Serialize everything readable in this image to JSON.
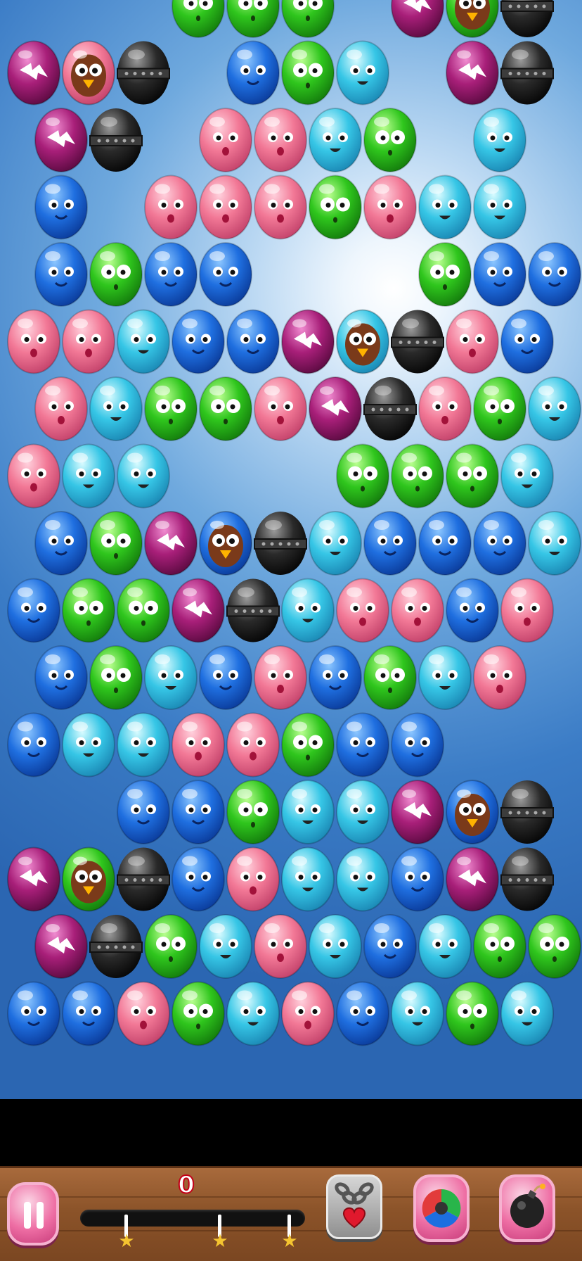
{
  "game": {
    "score": "0",
    "progress_fraction": 0.0,
    "star_thresholds": [
      0.2,
      0.62,
      0.92
    ]
  },
  "colors": {
    "blue": "#1f6fe0",
    "green": "#2fc61d",
    "pink": "#f27896",
    "cyan": "#36c6e6",
    "purple": "#a81f79",
    "black": "#2a2a2a"
  },
  "bubble_rows": [
    {
      "offset": false,
      "cells": [
        "",
        "",
        "",
        "green",
        "green",
        "green",
        "",
        "purple",
        "bird-green",
        "black"
      ]
    },
    {
      "offset": false,
      "cells": [
        "purple",
        "bird-pink",
        "black",
        "",
        "blue",
        "green",
        "cyan",
        "",
        "purple",
        "black"
      ]
    },
    {
      "offset": true,
      "cells": [
        "purple",
        "black",
        "",
        "pink",
        "pink",
        "cyan",
        "green",
        "",
        "cyan",
        ""
      ]
    },
    {
      "offset": true,
      "cells": [
        "blue",
        "",
        "pink",
        "pink",
        "pink",
        "green",
        "pink",
        "cyan",
        "cyan",
        ""
      ]
    },
    {
      "offset": true,
      "cells": [
        "blue",
        "green",
        "blue",
        "blue",
        "",
        "",
        "",
        "green",
        "blue",
        "blue"
      ]
    },
    {
      "offset": false,
      "cells": [
        "pink",
        "pink",
        "cyan",
        "blue",
        "blue",
        "purple",
        "bird-cyan",
        "black",
        "pink",
        "blue"
      ]
    },
    {
      "offset": true,
      "cells": [
        "pink",
        "cyan",
        "green",
        "green",
        "pink",
        "purple",
        "black",
        "pink",
        "green",
        "cyan"
      ]
    },
    {
      "offset": false,
      "cells": [
        "pink",
        "cyan",
        "cyan",
        "",
        "",
        "",
        "green",
        "green",
        "green",
        "cyan"
      ]
    },
    {
      "offset": true,
      "cells": [
        "blue",
        "green",
        "purple",
        "bird-blue",
        "black",
        "cyan",
        "blue",
        "blue",
        "blue",
        "cyan"
      ]
    },
    {
      "offset": false,
      "cells": [
        "blue",
        "green",
        "green",
        "purple",
        "black",
        "cyan",
        "pink",
        "pink",
        "blue",
        "pink"
      ]
    },
    {
      "offset": true,
      "cells": [
        "blue",
        "green",
        "cyan",
        "blue",
        "pink",
        "blue",
        "green",
        "cyan",
        "pink",
        ""
      ]
    },
    {
      "offset": false,
      "cells": [
        "blue",
        "cyan",
        "cyan",
        "pink",
        "pink",
        "green",
        "blue",
        "blue",
        "",
        ""
      ]
    },
    {
      "offset": false,
      "cells": [
        "",
        "",
        "blue",
        "blue",
        "green",
        "cyan",
        "cyan",
        "purple",
        "bird-blue",
        "black"
      ]
    },
    {
      "offset": false,
      "cells": [
        "purple",
        "bird-green",
        "black",
        "blue",
        "pink",
        "cyan",
        "cyan",
        "blue",
        "purple",
        "black"
      ]
    },
    {
      "offset": true,
      "cells": [
        "purple",
        "black",
        "green",
        "cyan",
        "pink",
        "cyan",
        "blue",
        "cyan",
        "green",
        "green"
      ]
    },
    {
      "offset": false,
      "cells": [
        "blue",
        "blue",
        "pink",
        "green",
        "cyan",
        "pink",
        "blue",
        "cyan",
        "green",
        "cyan"
      ]
    }
  ],
  "icons": {
    "pause": "pause-icon",
    "chain": "chain-lock-heart-icon",
    "rainbow": "rainbow-ball-icon",
    "bomb": "bomb-icon",
    "star": "star-icon"
  }
}
